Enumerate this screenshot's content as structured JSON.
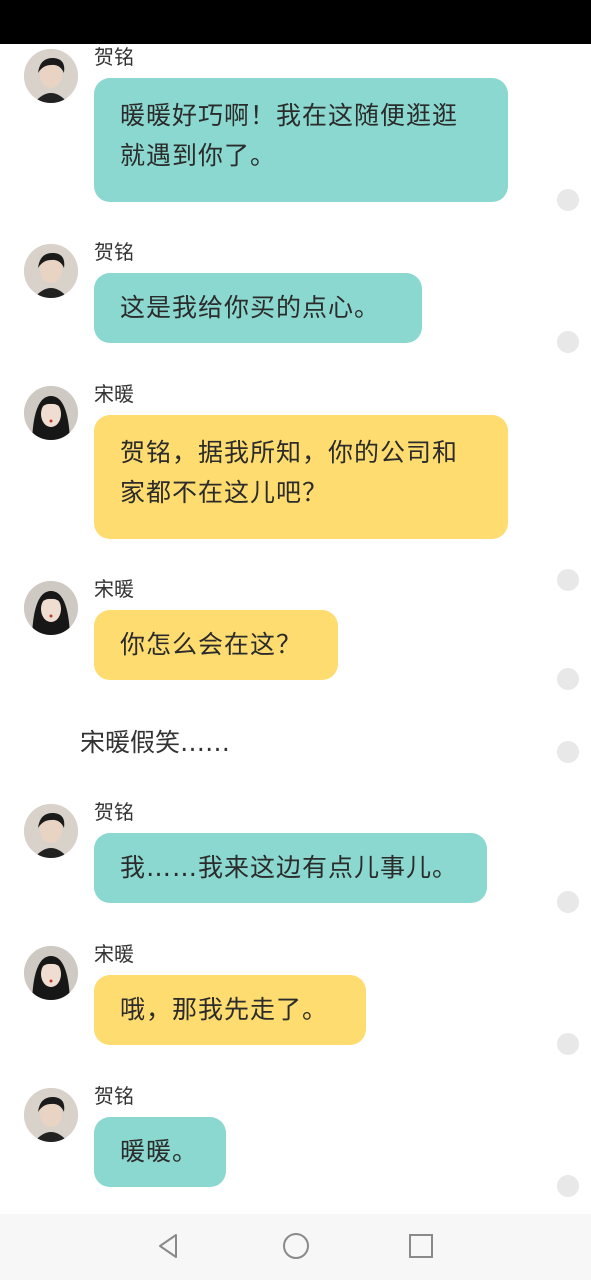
{
  "characters": {
    "male": {
      "name": "贺铭",
      "avatar_icon": "male-avatar-icon"
    },
    "female": {
      "name": "宋暖",
      "avatar_icon": "female-avatar-icon"
    }
  },
  "colors": {
    "male_bubble": "#8ad8cf",
    "female_bubble": "#fedc6f",
    "status_bar": "#000000"
  },
  "messages": [
    {
      "speaker": "贺铭",
      "lines": [
        "暖暖好巧啊！我在这随便逛逛",
        "就遇到你了。"
      ]
    },
    {
      "speaker": "贺铭",
      "lines": [
        "这是我给你买的点心。"
      ]
    },
    {
      "speaker": "宋暖",
      "lines": [
        "贺铭，据我所知，你的公司和",
        "家都不在这儿吧？"
      ]
    },
    {
      "speaker": "宋暖",
      "lines": [
        "你怎么会在这？"
      ]
    },
    {
      "narration": "宋暖假笑……"
    },
    {
      "speaker": "贺铭",
      "lines": [
        "我……我来这边有点儿事儿。"
      ]
    },
    {
      "speaker": "宋暖",
      "lines": [
        "哦，那我先走了。"
      ]
    },
    {
      "speaker": "贺铭",
      "lines": [
        "暖暖。"
      ]
    }
  ],
  "nav": {
    "back_icon": "back-triangle-icon",
    "home_icon": "home-circle-icon",
    "recent_icon": "recent-square-icon"
  }
}
